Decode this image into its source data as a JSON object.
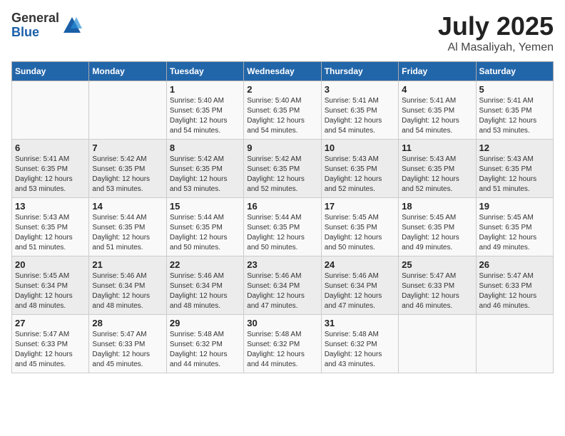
{
  "logo": {
    "general": "General",
    "blue": "Blue"
  },
  "header": {
    "month": "July 2025",
    "location": "Al Masaliyah, Yemen"
  },
  "weekdays": [
    "Sunday",
    "Monday",
    "Tuesday",
    "Wednesday",
    "Thursday",
    "Friday",
    "Saturday"
  ],
  "weeks": [
    [
      {
        "day": "",
        "info": ""
      },
      {
        "day": "",
        "info": ""
      },
      {
        "day": "1",
        "info": "Sunrise: 5:40 AM\nSunset: 6:35 PM\nDaylight: 12 hours and 54 minutes."
      },
      {
        "day": "2",
        "info": "Sunrise: 5:40 AM\nSunset: 6:35 PM\nDaylight: 12 hours and 54 minutes."
      },
      {
        "day": "3",
        "info": "Sunrise: 5:41 AM\nSunset: 6:35 PM\nDaylight: 12 hours and 54 minutes."
      },
      {
        "day": "4",
        "info": "Sunrise: 5:41 AM\nSunset: 6:35 PM\nDaylight: 12 hours and 54 minutes."
      },
      {
        "day": "5",
        "info": "Sunrise: 5:41 AM\nSunset: 6:35 PM\nDaylight: 12 hours and 53 minutes."
      }
    ],
    [
      {
        "day": "6",
        "info": "Sunrise: 5:41 AM\nSunset: 6:35 PM\nDaylight: 12 hours and 53 minutes."
      },
      {
        "day": "7",
        "info": "Sunrise: 5:42 AM\nSunset: 6:35 PM\nDaylight: 12 hours and 53 minutes."
      },
      {
        "day": "8",
        "info": "Sunrise: 5:42 AM\nSunset: 6:35 PM\nDaylight: 12 hours and 53 minutes."
      },
      {
        "day": "9",
        "info": "Sunrise: 5:42 AM\nSunset: 6:35 PM\nDaylight: 12 hours and 52 minutes."
      },
      {
        "day": "10",
        "info": "Sunrise: 5:43 AM\nSunset: 6:35 PM\nDaylight: 12 hours and 52 minutes."
      },
      {
        "day": "11",
        "info": "Sunrise: 5:43 AM\nSunset: 6:35 PM\nDaylight: 12 hours and 52 minutes."
      },
      {
        "day": "12",
        "info": "Sunrise: 5:43 AM\nSunset: 6:35 PM\nDaylight: 12 hours and 51 minutes."
      }
    ],
    [
      {
        "day": "13",
        "info": "Sunrise: 5:43 AM\nSunset: 6:35 PM\nDaylight: 12 hours and 51 minutes."
      },
      {
        "day": "14",
        "info": "Sunrise: 5:44 AM\nSunset: 6:35 PM\nDaylight: 12 hours and 51 minutes."
      },
      {
        "day": "15",
        "info": "Sunrise: 5:44 AM\nSunset: 6:35 PM\nDaylight: 12 hours and 50 minutes."
      },
      {
        "day": "16",
        "info": "Sunrise: 5:44 AM\nSunset: 6:35 PM\nDaylight: 12 hours and 50 minutes."
      },
      {
        "day": "17",
        "info": "Sunrise: 5:45 AM\nSunset: 6:35 PM\nDaylight: 12 hours and 50 minutes."
      },
      {
        "day": "18",
        "info": "Sunrise: 5:45 AM\nSunset: 6:35 PM\nDaylight: 12 hours and 49 minutes."
      },
      {
        "day": "19",
        "info": "Sunrise: 5:45 AM\nSunset: 6:35 PM\nDaylight: 12 hours and 49 minutes."
      }
    ],
    [
      {
        "day": "20",
        "info": "Sunrise: 5:45 AM\nSunset: 6:34 PM\nDaylight: 12 hours and 48 minutes."
      },
      {
        "day": "21",
        "info": "Sunrise: 5:46 AM\nSunset: 6:34 PM\nDaylight: 12 hours and 48 minutes."
      },
      {
        "day": "22",
        "info": "Sunrise: 5:46 AM\nSunset: 6:34 PM\nDaylight: 12 hours and 48 minutes."
      },
      {
        "day": "23",
        "info": "Sunrise: 5:46 AM\nSunset: 6:34 PM\nDaylight: 12 hours and 47 minutes."
      },
      {
        "day": "24",
        "info": "Sunrise: 5:46 AM\nSunset: 6:34 PM\nDaylight: 12 hours and 47 minutes."
      },
      {
        "day": "25",
        "info": "Sunrise: 5:47 AM\nSunset: 6:33 PM\nDaylight: 12 hours and 46 minutes."
      },
      {
        "day": "26",
        "info": "Sunrise: 5:47 AM\nSunset: 6:33 PM\nDaylight: 12 hours and 46 minutes."
      }
    ],
    [
      {
        "day": "27",
        "info": "Sunrise: 5:47 AM\nSunset: 6:33 PM\nDaylight: 12 hours and 45 minutes."
      },
      {
        "day": "28",
        "info": "Sunrise: 5:47 AM\nSunset: 6:33 PM\nDaylight: 12 hours and 45 minutes."
      },
      {
        "day": "29",
        "info": "Sunrise: 5:48 AM\nSunset: 6:32 PM\nDaylight: 12 hours and 44 minutes."
      },
      {
        "day": "30",
        "info": "Sunrise: 5:48 AM\nSunset: 6:32 PM\nDaylight: 12 hours and 44 minutes."
      },
      {
        "day": "31",
        "info": "Sunrise: 5:48 AM\nSunset: 6:32 PM\nDaylight: 12 hours and 43 minutes."
      },
      {
        "day": "",
        "info": ""
      },
      {
        "day": "",
        "info": ""
      }
    ]
  ]
}
